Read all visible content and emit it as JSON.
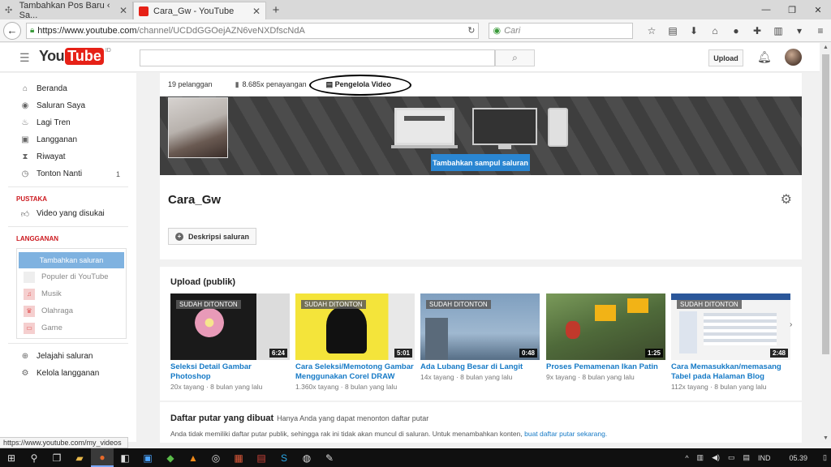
{
  "browser": {
    "tabs": [
      {
        "title": "Tambahkan Pos Baru ‹ Sa..."
      },
      {
        "title": "Cara_Gw - YouTube"
      }
    ],
    "new_tab": "+",
    "url_host": "https://www.youtube.com",
    "url_path": "/channel/UCDdGGOejAZN6veNXDfscNdA",
    "search_placeholder": "Cari",
    "status_url": "https://www.youtube.com/my_videos"
  },
  "youtube": {
    "logo_you": "You",
    "logo_tube": "Tube",
    "logo_country": "ID",
    "upload_label": "Upload"
  },
  "sidebar": {
    "items": [
      {
        "label": "Beranda",
        "icon": "home-icon"
      },
      {
        "label": "Saluran Saya",
        "icon": "user-icon"
      },
      {
        "label": "Lagi Tren",
        "icon": "flame-icon"
      },
      {
        "label": "Langganan",
        "icon": "subscriptions-icon"
      },
      {
        "label": "Riwayat",
        "icon": "hourglass-icon"
      },
      {
        "label": "Tonton Nanti",
        "icon": "clock-icon",
        "badge": "1"
      }
    ],
    "library_heading": "PUSTAKA",
    "library_items": [
      {
        "label": "Video yang disukai"
      }
    ],
    "subscriptions_heading": "LANGGANAN",
    "add_channel_label": "Tambahkan saluran",
    "subscription_items": [
      {
        "label": "Populer di YouTube"
      },
      {
        "label": "Musik"
      },
      {
        "label": "Olahraga"
      },
      {
        "label": "Game"
      }
    ],
    "bottom_items": [
      {
        "label": "Jelajahi saluran"
      },
      {
        "label": "Kelola langganan"
      }
    ]
  },
  "channel": {
    "subscribers": "19 pelanggan",
    "views": "8.685x penayangan",
    "video_manager": "Pengelola Video",
    "add_banner_label": "Tambahkan sampul saluran",
    "name": "Cara_Gw",
    "description_button": "Deskripsi saluran"
  },
  "uploads": {
    "heading": "Upload (publik)",
    "watched_label": "SUDAH DITONTON",
    "videos": [
      {
        "title_line1": "Seleksi Detail Gambar Photoshop",
        "title_line2": "",
        "meta": "20x tayang · 8 bulan yang lalu",
        "duration": "6:24"
      },
      {
        "title_line1": "Cara Seleksi/Memotong Gambar",
        "title_line2": "Menggunakan Corel DRAW",
        "meta": "1.360x tayang · 8 bulan yang lalu",
        "duration": "5:01"
      },
      {
        "title_line1": "Ada Lubang Besar di Langit",
        "title_line2": "",
        "meta": "14x tayang · 8 bulan yang lalu",
        "duration": "0:48"
      },
      {
        "title_line1": "Proses Pemamenan Ikan Patin",
        "title_line2": "",
        "meta": "9x tayang · 8 bulan yang lalu",
        "duration": "1:25"
      },
      {
        "title_line1": "Cara Memasukkan/memasang",
        "title_line2": "Tabel pada Halaman Blog",
        "meta": "112x tayang · 8 bulan yang lalu",
        "duration": "2:48"
      }
    ]
  },
  "playlists": {
    "heading": "Daftar putar yang dibuat",
    "note": "Hanya Anda yang dapat menonton daftar putar",
    "description": "Anda tidak memiliki daftar putar publik, sehingga rak ini tidak akan muncul di saluran. Untuk menambahkan konten,",
    "link": "buat daftar putar sekarang."
  },
  "taskbar": {
    "language": "IND",
    "time": "05.39"
  }
}
